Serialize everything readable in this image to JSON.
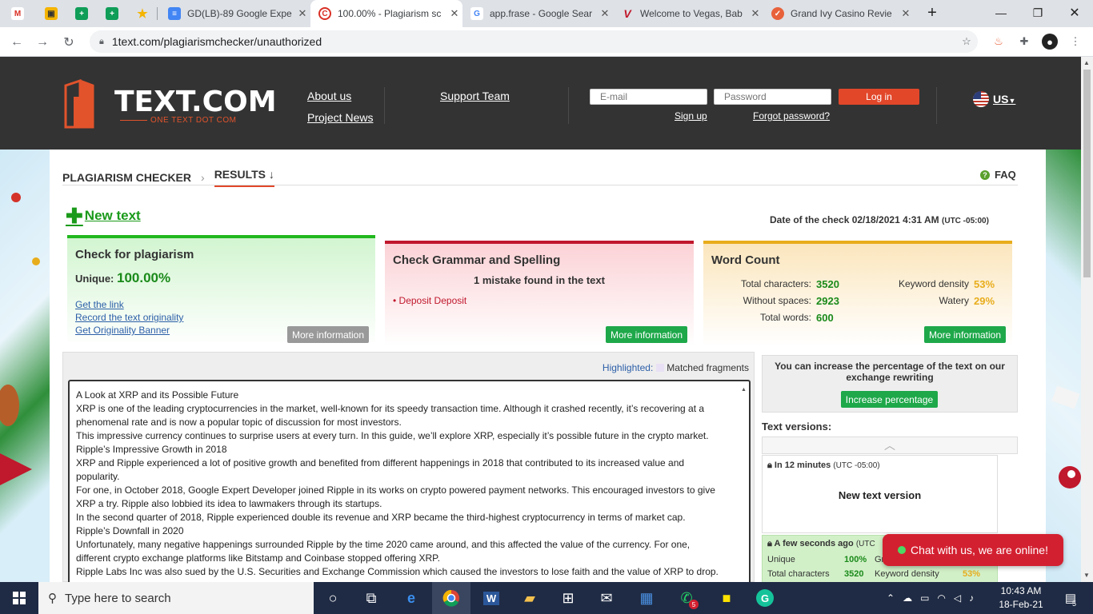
{
  "browser": {
    "pinned": [
      "M",
      "▣",
      "+",
      "+",
      "★"
    ],
    "tabs": [
      {
        "title": "GD(LB)-89 Google Expe",
        "icon": "docs-icon",
        "color": "#4285f4"
      },
      {
        "title": "100.00% - Plagiarism sc",
        "icon": "copyright-icon",
        "color": "#d93025"
      },
      {
        "title": "app.frase - Google Sear",
        "icon": "google-icon",
        "color": "#ffffff"
      },
      {
        "title": "Welcome to Vegas, Bab",
        "icon": "vegas-icon",
        "color": "#ffffff"
      },
      {
        "title": "Grand Ivy Casino Revie",
        "icon": "check-icon",
        "color": "#e8613a"
      }
    ],
    "url": "1text.com/plagiarismchecker/unauthorized"
  },
  "header": {
    "logo_text": "TEXT.COM",
    "logo_sub": "ONE TEXT DOT COM",
    "about": "About us",
    "news": "Project News",
    "support": "Support Team",
    "email_placeholder": "E-mail",
    "password_placeholder": "Password",
    "login": "Log in",
    "signup": "Sign up",
    "forgot": "Forgot password?",
    "lang": "US"
  },
  "breadcrumb": {
    "first": "PLAGIARISM CHECKER",
    "second": "RESULTS ↓",
    "faq": "FAQ"
  },
  "new_text": "New text",
  "date_check": {
    "label": "Date of the check 02/18/2021 4:31 AM",
    "tz": "(UTC -05:00)"
  },
  "plag": {
    "title": "Check for plagiarism",
    "unique_label": "Unique:",
    "unique_value": "100.00%",
    "links": [
      "Get the link",
      "Record the text originality",
      "Get Originality Banner"
    ],
    "more": "More information"
  },
  "grammar": {
    "title": "Check Grammar and Spelling",
    "mistakes": "1 mistake found in the text",
    "error": "• Deposit Deposit",
    "more": "More information"
  },
  "words": {
    "title": "Word Count",
    "total_chars_label": "Total characters:",
    "total_chars": "3520",
    "without_spaces_label": "Without spaces:",
    "without_spaces": "2923",
    "total_words_label": "Total words:",
    "total_words": "600",
    "density_label": "Keyword density",
    "density": "53%",
    "watery_label": "Watery",
    "watery": "29%",
    "more": "More information"
  },
  "highlight": {
    "label": "Highlighted:",
    "matched": "Matched fragments"
  },
  "text_lines": [
    "A Look at XRP and its Possible Future",
    "XRP is one of the leading cryptocurrencies in the market, well-known for its speedy transaction time. Although it crashed recently, it’s recovering at a",
    "phenomenal rate and is now a popular topic of discussion for most investors.",
    "This impressive currency continues to surprise users at every turn. In this guide, we’ll explore XRP, especially it’s possible future in the crypto market.",
    "Ripple’s Impressive Growth in 2018",
    "XRP and Ripple experienced a lot of positive growth and benefited from different happenings in 2018 that contributed to its increased value and",
    "popularity.",
    "For one, in October 2018, Google Expert Developer joined Ripple in its works on crypto powered payment networks. This encouraged investors to give",
    "XRP a try. Ripple also lobbied its idea to lawmakers through its startups.",
    "In the second quarter of 2018, Ripple experienced double its revenue and XRP became the third-highest cryptocurrency in terms of market cap.",
    "Ripple’s Downfall in 2020",
    "Unfortunately, many negative happenings surrounded Ripple by the time 2020 came around, and this affected the value of the currency. For one,",
    "different crypto exchange platforms like Bitstamp and Coinbase stopped offering XRP.",
    "Ripple Labs Inc was also sued by the U.S. Securities and Exchange Commission which caused the investors to lose faith and the value of XRP to drop."
  ],
  "increase": {
    "text": "You can increase the percentage of the text on our exchange rewriting",
    "button": "Increase percentage"
  },
  "versions": {
    "label": "Text versions:",
    "v1_time": "In 12 minutes",
    "v1_tz": "(UTC -05:00)",
    "v1_name": "New text version",
    "v2_time": "A few seconds ago",
    "v2_tz": "(UTC",
    "v2_unique_label": "Unique",
    "v2_unique": "100%",
    "v2_total_label": "Total characters",
    "v2_total": "3520",
    "v2_density_label": "Keyword density",
    "v2_density": "53%",
    "v2_gr": "Gr"
  },
  "chat": "Chat with us, we are online!",
  "taskbar": {
    "search": "Type here to search",
    "time": "10:43 AM",
    "date": "18-Feb-21",
    "notif": "5",
    "whatsapp_badge": "5"
  }
}
